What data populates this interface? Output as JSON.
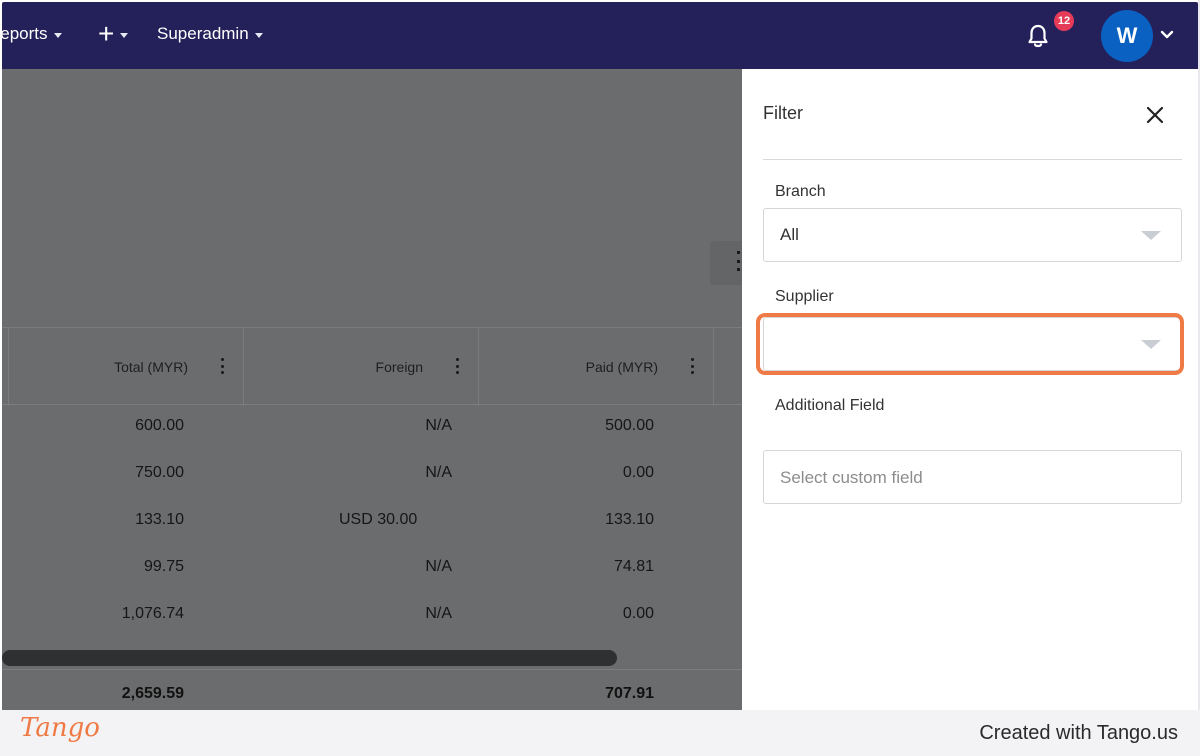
{
  "nav": {
    "reports_label": "Reports",
    "add_label": "+",
    "superadmin_label": "Superadmin",
    "notification_count": "12",
    "avatar_initial": "W"
  },
  "table": {
    "columns": [
      {
        "label": "Total (MYR)"
      },
      {
        "label": "Foreign"
      },
      {
        "label": "Paid (MYR)"
      }
    ],
    "rows": [
      {
        "total": "600.00",
        "foreign": "N/A",
        "paid": "500.00"
      },
      {
        "total": "750.00",
        "foreign": "N/A",
        "paid": "0.00"
      },
      {
        "total": "133.10",
        "foreign": "USD 30.00",
        "paid": "133.10"
      },
      {
        "total": "99.75",
        "foreign": "N/A",
        "paid": "74.81"
      },
      {
        "total": "1,076.74",
        "foreign": "N/A",
        "paid": "0.00"
      }
    ],
    "totals": {
      "total": "2,659.59",
      "paid": "707.91"
    }
  },
  "filter": {
    "title": "Filter",
    "branch_label": "Branch",
    "branch_value": "All",
    "supplier_label": "Supplier",
    "supplier_value": "",
    "additional_label": "Additional Field",
    "additional_placeholder": "Select custom field"
  },
  "footer": {
    "logo_text": "Tango",
    "created_text": "Created with Tango.us"
  },
  "colors": {
    "nav_bg": "#24205a",
    "avatar_bg": "#0a61c2",
    "badge_bg": "#e53b59",
    "highlight": "#f07a45",
    "overlay": "#6b6c6d"
  }
}
